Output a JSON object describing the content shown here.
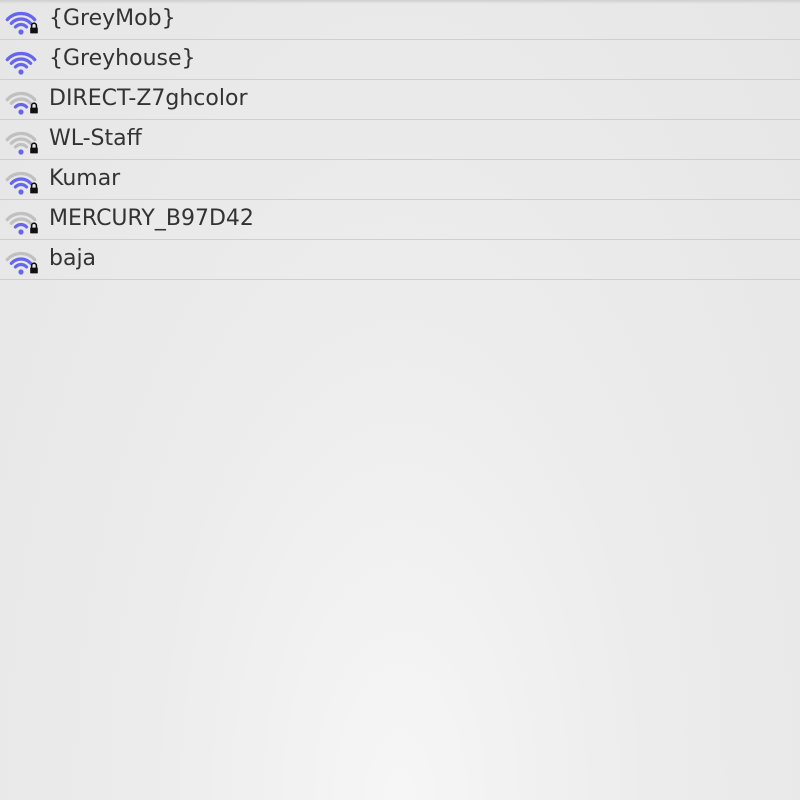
{
  "colors": {
    "signal_active": "#6565ee",
    "signal_inactive": "#c0c0c0",
    "lock": "#111111",
    "text": "#333333",
    "divider": "#cfcfcf"
  },
  "networks": [
    {
      "ssid": "{GreyMob}",
      "signal_bars": 4,
      "secured": true
    },
    {
      "ssid": "{Greyhouse}",
      "signal_bars": 4,
      "secured": false
    },
    {
      "ssid": "DIRECT-Z7ghcolor",
      "signal_bars": 2,
      "secured": true
    },
    {
      "ssid": "WL-Staff",
      "signal_bars": 1,
      "secured": true
    },
    {
      "ssid": "Kumar",
      "signal_bars": 3,
      "secured": true
    },
    {
      "ssid": "MERCURY_B97D42",
      "signal_bars": 2,
      "secured": true
    },
    {
      "ssid": "baja",
      "signal_bars": 3,
      "secured": true
    }
  ]
}
